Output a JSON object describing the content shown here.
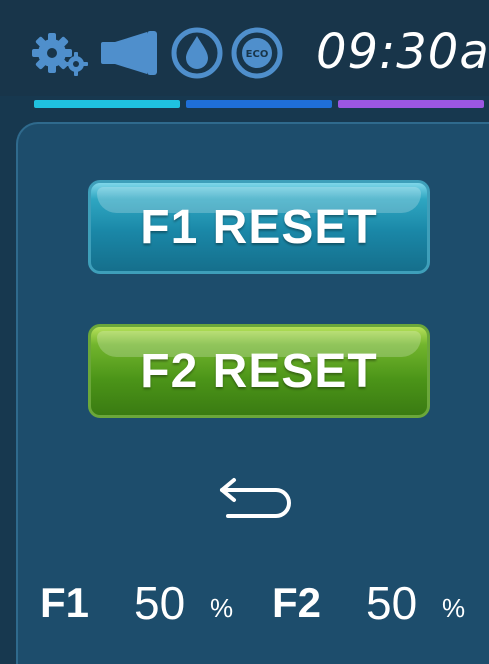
{
  "status_bar": {
    "icons": [
      "gear-icon",
      "speaker-icon",
      "drop-icon",
      "eco-icon"
    ],
    "eco_text": "ECO",
    "time": "09:30a",
    "tab_colors": [
      "#1fc1e0",
      "#1f6fd8",
      "#9b57e2"
    ]
  },
  "buttons": {
    "f1_reset": "F1 RESET",
    "f2_reset": "F2 RESET"
  },
  "back": {
    "icon": "back-arrow-icon"
  },
  "footer": {
    "f1_label": "F1",
    "f1_value": "50",
    "f1_unit": "%",
    "f2_label": "F2",
    "f2_value": "50",
    "f2_unit": "%"
  },
  "colors": {
    "background": "#17384f",
    "panel": "#1d4d6c",
    "f1_button": "#1a87a7",
    "f2_button": "#4b9418"
  }
}
